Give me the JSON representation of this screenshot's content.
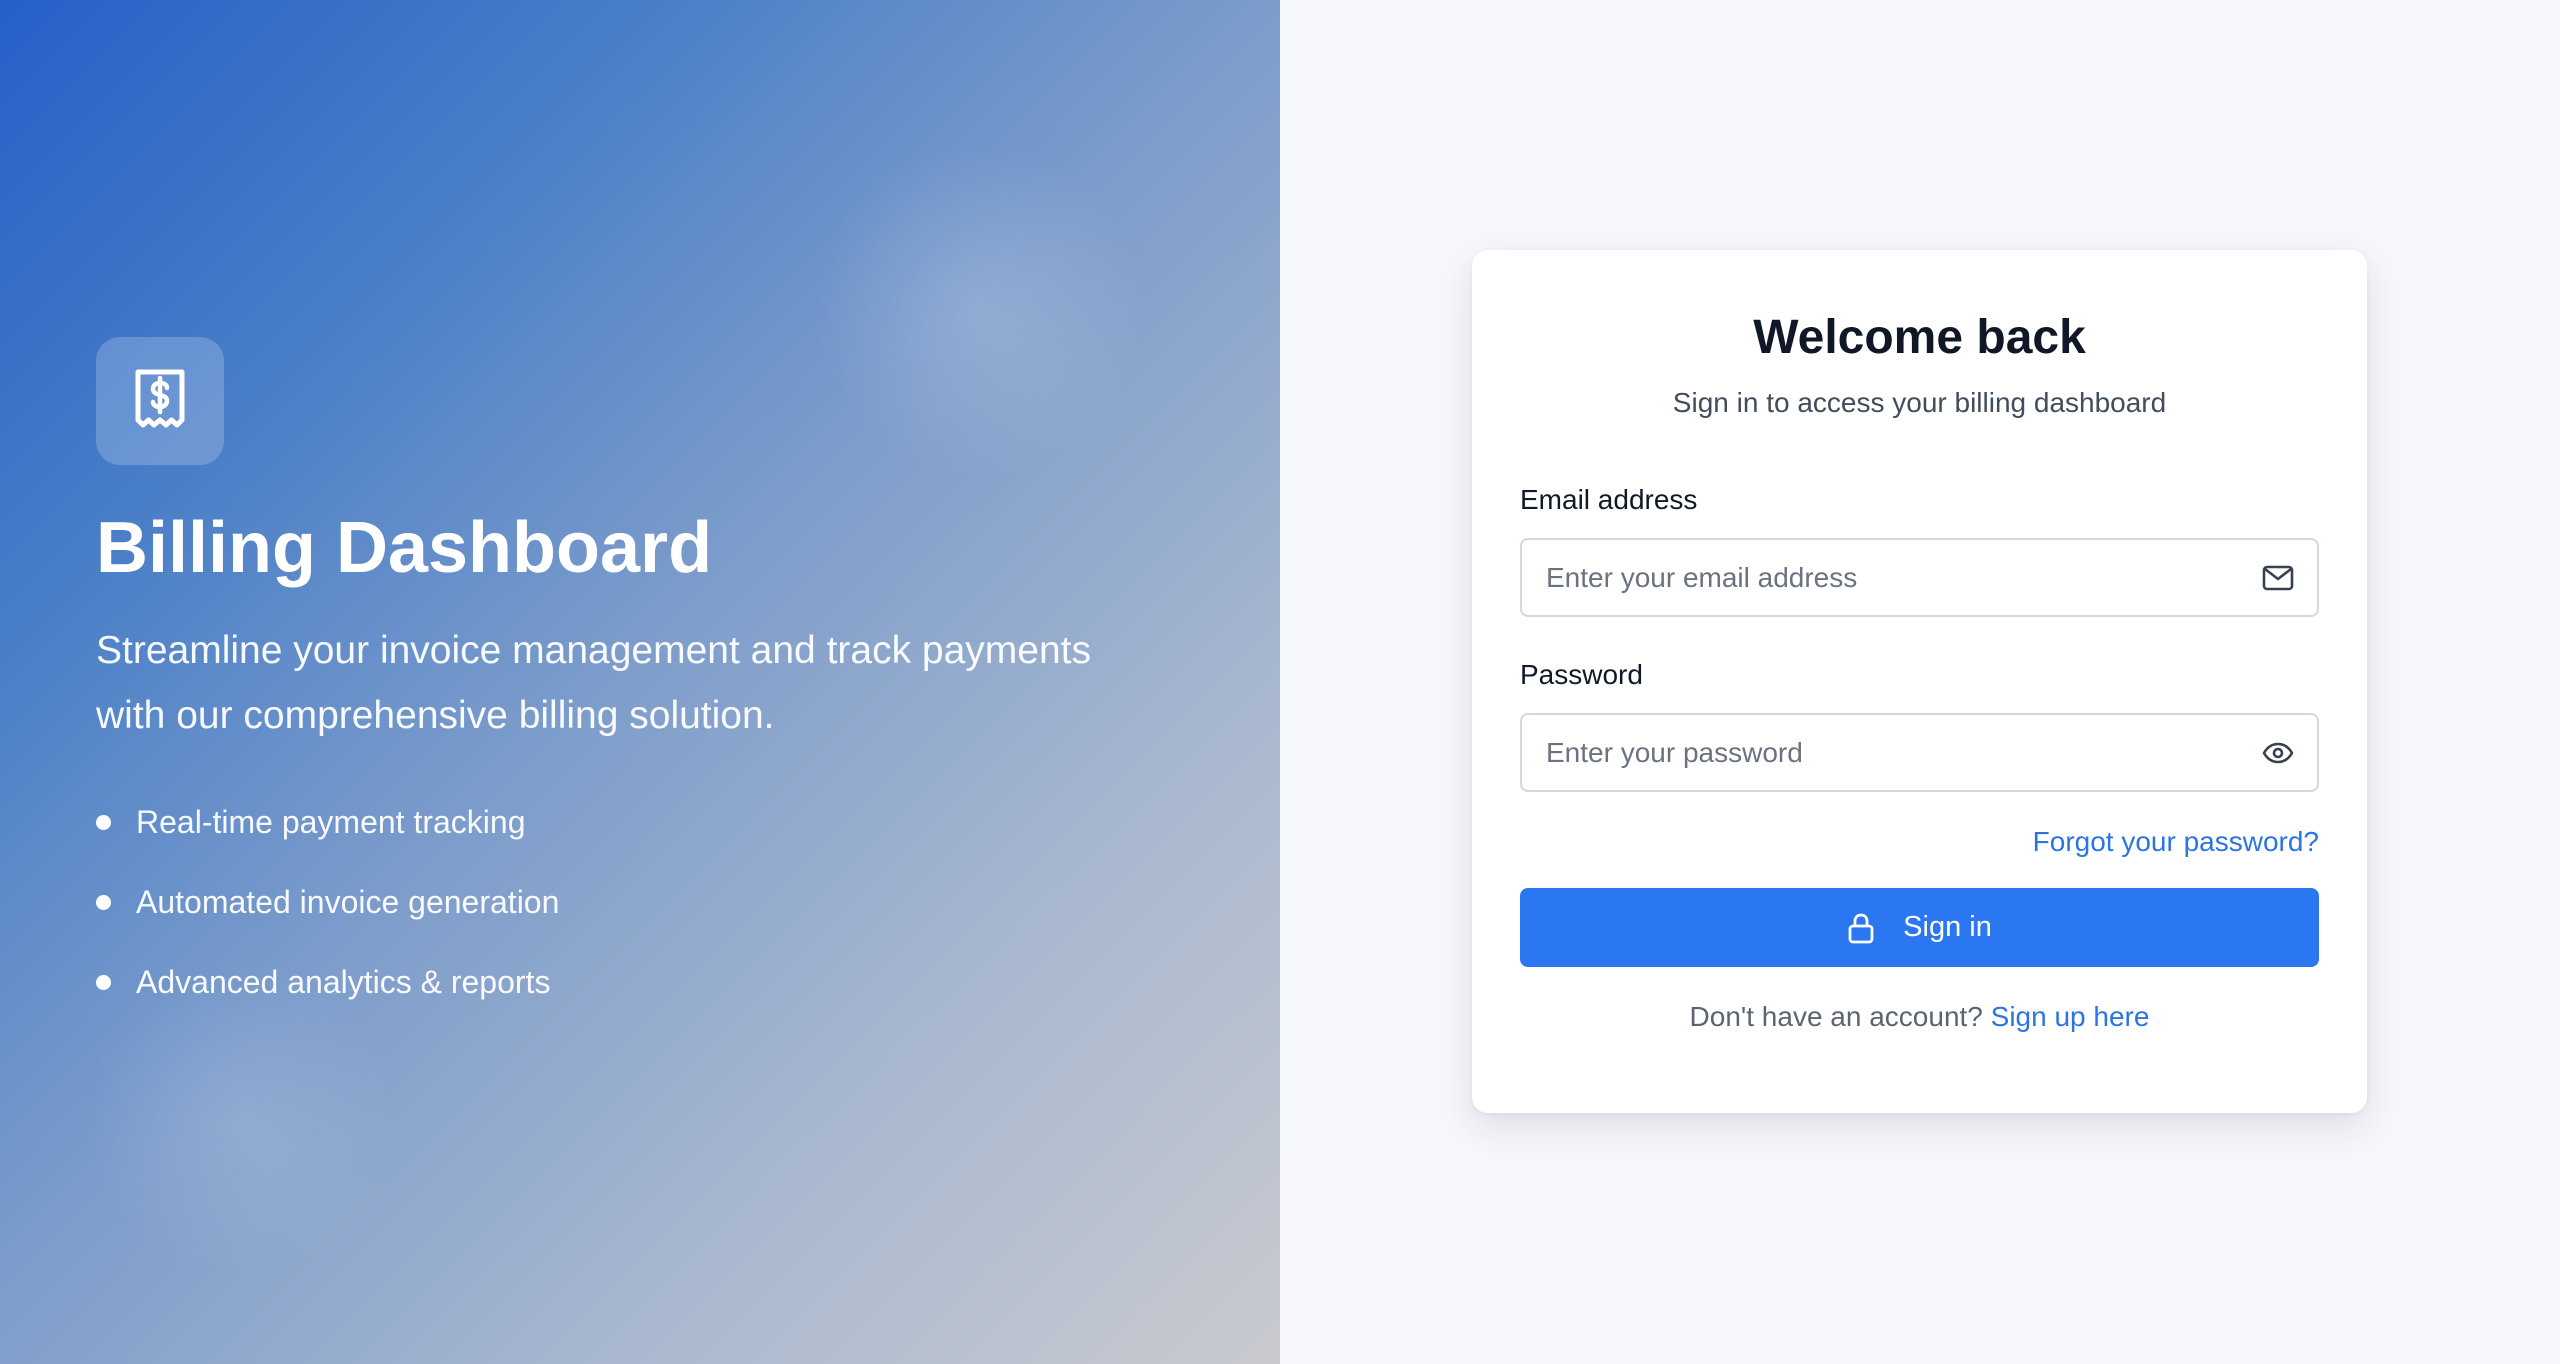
{
  "hero": {
    "logo_icon": "receipt-dollar-icon",
    "title": "Billing Dashboard",
    "subtitle": "Streamline your invoice management and track payments with our comprehensive billing solution.",
    "features": [
      "Real-time payment tracking",
      "Automated invoice generation",
      "Advanced analytics & reports"
    ]
  },
  "login": {
    "title": "Welcome back",
    "subtitle": "Sign in to access your billing dashboard",
    "email": {
      "label": "Email address",
      "value": "",
      "placeholder": "Enter your email address",
      "icon": "mail-icon"
    },
    "password": {
      "label": "Password",
      "value": "",
      "placeholder": "Enter your password",
      "icon": "eye-icon"
    },
    "forgot_link": "Forgot your password?",
    "submit_label": "Sign in",
    "submit_icon": "lock-icon",
    "signup_prompt": "Don't have an account?",
    "signup_link": "Sign up here"
  },
  "colors": {
    "primary": "#2b76f1",
    "link": "#2b74e6",
    "heading": "#101828",
    "hero_gradient_start": "#2560c9",
    "hero_gradient_end": "#c9cacf"
  }
}
